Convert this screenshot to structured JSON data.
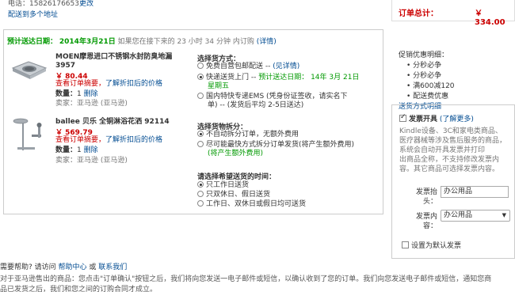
{
  "address": {
    "phone": "电话：15826176653",
    "change": "更改",
    "multi": "配送到多个地址"
  },
  "summary": {
    "label": "订单总计：",
    "amount": "￥ 334.00"
  },
  "delivery": {
    "label": "预计送达日期：",
    "date": "2014年3月21日",
    "note": "如果您在接下来的 23 小时 34 分钟 内订购",
    "details": "(详情)"
  },
  "items": [
    {
      "title1": "MOEN摩恩进口不锈钢水封防臭地漏",
      "title2": "3957",
      "price": "￥ 80.44",
      "notice": "查看订单摘要，",
      "notice_link": "了解折扣后的价格",
      "qty_label": "数量：",
      "qty": "1",
      "delete": "删除",
      "seller": "卖家：亚马逊 (亚马逊)"
    },
    {
      "title1": "ballee 贝乐 全铜淋浴花洒 92114",
      "title2": "",
      "price": "￥ 569.79",
      "notice": "查看订单摘要，",
      "notice_link": "了解折扣后的价格",
      "qty_label": "数量：",
      "qty": "1",
      "delete": "删除",
      "seller": "卖家：亚马逊 (亚马逊)"
    }
  ],
  "shipping": {
    "heading": "选择货方式：",
    "opt1": "免费自营包邮配送 -- ",
    "opt1_link": "(见详情)",
    "opt2": "快递送货上门 -- ",
    "opt2_date": "预计送达日期： 14年 3月 21日",
    "opt2_day": "星期五",
    "opt3a": "国内特快专递EMS (凭身份证签收，请实名下",
    "opt3b": "单)  --  (发货后平均 2-5日送达)"
  },
  "split": {
    "heading": "选择货物拆分：",
    "opt1": "不自动拆分订单，无额外费用",
    "opt2a": "尽可能最快方式拆分订单发货(将产生额外费用)",
    "opt2b": "(将产生额外费用)"
  },
  "time": {
    "heading": "请选择希望送货的时间：",
    "opt1": "只工作日送货",
    "opt2": "只双休日、假日送货",
    "opt3": "工作日、双休日或假日均可送货"
  },
  "promo": {
    "heading": "促销优惠明细：",
    "items": [
      "分秒必争",
      "分秒必争",
      "满600减120",
      "配送费优惠"
    ],
    "link": "送货方式明细"
  },
  "invoice": {
    "title": "发票开具",
    "more": "(了解更多)",
    "desc": [
      "Kindle设备、3C和家电类商品、",
      "医疗器械等涉及售后服务的商品，",
      "系统会自动开具发票并打印",
      "出商品全称，不支持修改发票内",
      "容。其它商品可选择发票内容。"
    ],
    "header_label1": "发票抬",
    "header_label2": "头：",
    "header_value": "办公用品",
    "content_label1": "发票内",
    "content_label2": "容：",
    "content_value": "办公用品",
    "default_label": "设置为默认发票"
  },
  "help": {
    "text": "需要帮助? 请访问",
    "center": "帮助中心",
    "or": "或",
    "contact": "联系我们"
  },
  "footer": {
    "line1": "对于亚马逊售出的商品：您点击\"订单确认\"按钮之后，我们将向您发送一电子邮件或短信，以确认收到了您的订单。我们向您发送电子邮件或短信，通知您商",
    "line2": "品已发货之后，我们和您之间的订购合同才成立。"
  }
}
